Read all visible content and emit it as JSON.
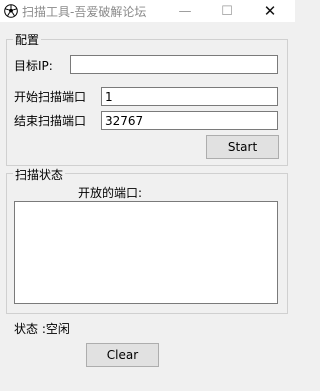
{
  "window": {
    "title": "扫描工具-吾爱破解论坛",
    "min_glyph": "—",
    "max_glyph": "☐",
    "close_glyph": "✕"
  },
  "config_group": {
    "title": "配置",
    "target_ip_label": "目标IP:",
    "target_ip_value": "",
    "start_port_label": "开始扫描端口",
    "start_port_value": "1",
    "end_port_label": "结束扫描端口",
    "end_port_value": "32767",
    "start_button": "Start"
  },
  "status_group": {
    "title": "扫描状态",
    "open_ports_label": "开放的端口:",
    "open_ports_items": []
  },
  "status_text": "状态 :空闲",
  "clear_button": "Clear"
}
